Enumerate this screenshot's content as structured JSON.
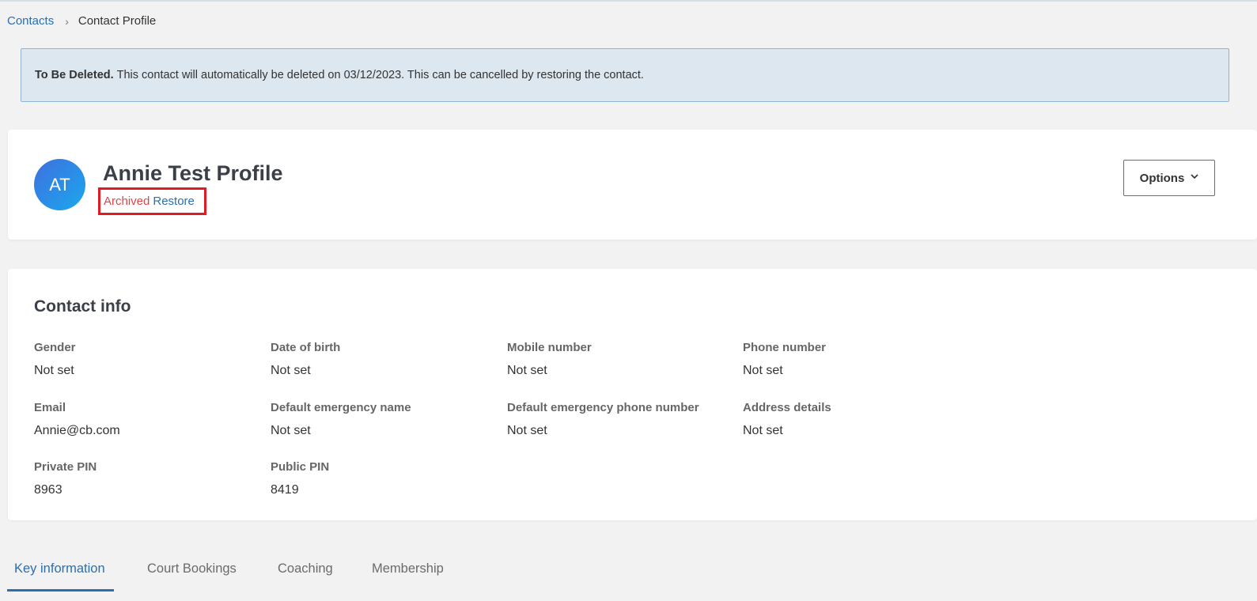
{
  "breadcrumb": {
    "parent": "Contacts",
    "separator": "›",
    "current": "Contact Profile"
  },
  "alert": {
    "title": "To Be Deleted.",
    "message": "This contact will automatically be deleted on 03/12/2023. This can be cancelled by restoring the contact."
  },
  "profile": {
    "initials": "AT",
    "name": "Annie Test Profile",
    "status": "Archived",
    "restore_label": "Restore",
    "options_label": "Options",
    "options_icon": "chevron-down-icon"
  },
  "contact_info": {
    "title": "Contact info",
    "fields": [
      {
        "label": "Gender",
        "value": "Not set"
      },
      {
        "label": "Date of birth",
        "value": "Not set"
      },
      {
        "label": "Mobile number",
        "value": "Not set"
      },
      {
        "label": "Phone number",
        "value": "Not set"
      },
      {
        "label": "Email",
        "value": "Annie@cb.com"
      },
      {
        "label": "Default emergency name",
        "value": "Not set"
      },
      {
        "label": "Default emergency phone number",
        "value": "Not set"
      },
      {
        "label": "Address details",
        "value": "Not set"
      },
      {
        "label": "Private PIN",
        "value": "8963"
      },
      {
        "label": "Public PIN",
        "value": "8419"
      }
    ]
  },
  "tabs": [
    {
      "label": "Key information",
      "active": true
    },
    {
      "label": "Court Bookings",
      "active": false
    },
    {
      "label": "Coaching",
      "active": false
    },
    {
      "label": "Membership",
      "active": false
    }
  ],
  "colors": {
    "link": "#2a6fb0",
    "archived": "#e0464a",
    "highlight_box": "#e01b24",
    "alert_bg": "#dde7ef"
  }
}
